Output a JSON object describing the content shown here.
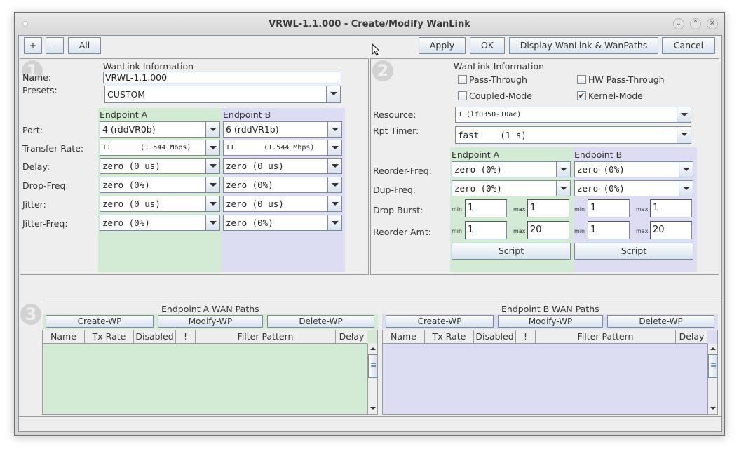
{
  "window": {
    "title": "VRWL-1.1.000 - Create/Modify WanLink",
    "controls": [
      "minimize",
      "maximize",
      "close"
    ]
  },
  "toolbar": {
    "plus_label": "+",
    "minus_label": "-",
    "all_label": "All",
    "apply_label": "Apply",
    "ok_label": "OK",
    "display_label": "Display WanLink & WanPaths",
    "cancel_label": "Cancel"
  },
  "panel1": {
    "badge": "1",
    "section_title": "WanLink Information",
    "name_label": "Name:",
    "name_value": "VRWL-1.1.000",
    "presets_label": "Presets:",
    "presets_value": "CUSTOM",
    "endpoint_a_header": "Endpoint A",
    "endpoint_b_header": "Endpoint B",
    "rows": [
      {
        "label": "Port:",
        "a": "4 (rddVR0b)",
        "b": "6 (rddVR1b)"
      },
      {
        "label": "Transfer Rate:",
        "a": "T1       (1.544 Mbps)",
        "b": "T1       (1.544 Mbps)"
      },
      {
        "label": "Delay:",
        "a": "zero (0 us)",
        "b": "zero (0 us)"
      },
      {
        "label": "Drop-Freq:",
        "a": "zero (0%)",
        "b": "zero (0%)"
      },
      {
        "label": "Jitter:",
        "a": "zero (0 us)",
        "b": "zero (0 us)"
      },
      {
        "label": "Jitter-Freq:",
        "a": "zero (0%)",
        "b": "zero (0%)"
      }
    ]
  },
  "panel2": {
    "badge": "2",
    "section_title": "WanLink Information",
    "checkboxes": [
      {
        "label": "Pass-Through",
        "checked": false
      },
      {
        "label": "HW Pass-Through",
        "checked": false
      },
      {
        "label": "Coupled-Mode",
        "checked": false
      },
      {
        "label": "Kernel-Mode",
        "checked": true
      }
    ],
    "check_glyph": "✔",
    "resource_label": "Resource:",
    "resource_value": "1 (lf0350-10ac)",
    "rpt_timer_label": "Rpt Timer:",
    "rpt_timer_value": "fast    (1 s)",
    "endpoint_a_header": "Endpoint A",
    "endpoint_b_header": "Endpoint B",
    "reorder_freq_label": "Reorder-Freq:",
    "reorder_freq_a": "zero (0%)",
    "reorder_freq_b": "zero (0%)",
    "dup_freq_label": "Dup-Freq:",
    "dup_freq_a": "zero (0%)",
    "dup_freq_b": "zero (0%)",
    "drop_burst_label": "Drop Burst:",
    "reorder_amt_label": "Reorder Amt:",
    "min_label": "min",
    "max_label": "max",
    "drop_burst_a": {
      "min": "1",
      "max": "1"
    },
    "drop_burst_b": {
      "min": "1",
      "max": "1"
    },
    "reorder_amt_a": {
      "min": "1",
      "max": "20"
    },
    "reorder_amt_b": {
      "min": "1",
      "max": "20"
    },
    "script_label": "Script"
  },
  "panel3": {
    "badge": "3",
    "endpoint_a_title": "Endpoint A WAN Paths",
    "endpoint_b_title": "Endpoint B WAN Paths",
    "create_label": "Create-WP",
    "modify_label": "Modify-WP",
    "delete_label": "Delete-WP",
    "columns": [
      "Name",
      "Tx Rate",
      "Disabled",
      "!",
      "Filter Pattern",
      "Delay"
    ],
    "rows_a": [],
    "rows_b": []
  },
  "colors": {
    "endpoint_a_bg": "#d3ead4",
    "endpoint_b_bg": "#dcdcf2",
    "panel_bg": "#eeeeee",
    "button_border": "#7a8a9a"
  }
}
